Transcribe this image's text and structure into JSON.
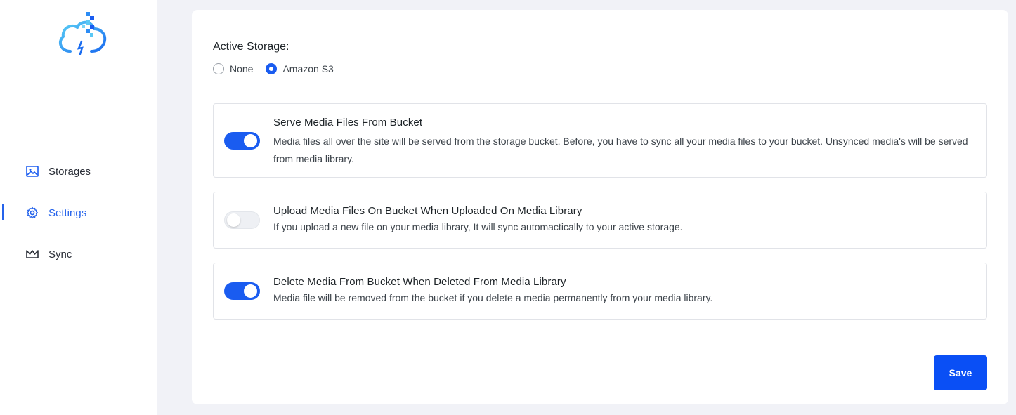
{
  "sidebar": {
    "items": [
      {
        "label": "Storages",
        "icon": "image-icon",
        "active": false
      },
      {
        "label": "Settings",
        "icon": "gear-icon",
        "active": true
      },
      {
        "label": "Sync",
        "icon": "crown-icon",
        "active": false
      }
    ]
  },
  "active_storage": {
    "label": "Active Storage:",
    "options": [
      {
        "label": "None",
        "selected": false
      },
      {
        "label": "Amazon S3",
        "selected": true
      }
    ]
  },
  "settings": [
    {
      "title": "Serve Media Files From Bucket",
      "description": "Media files all over the site will be served from the storage bucket. Before, you have to sync all your media files to your bucket. Unsynced media's will be served from media library.",
      "enabled": true
    },
    {
      "title": "Upload Media Files On Bucket When Uploaded On Media Library",
      "description": "If you upload a new file on your media library, It will sync automactically to your active storage.",
      "enabled": false
    },
    {
      "title": "Delete Media From Bucket When Deleted From Media Library",
      "description": "Media file will be removed from the bucket if you delete a media permanently from your media library.",
      "enabled": true
    }
  ],
  "footer": {
    "save_label": "Save"
  },
  "colors": {
    "accent": "#1a5cf0",
    "button": "#0a4ff5"
  }
}
